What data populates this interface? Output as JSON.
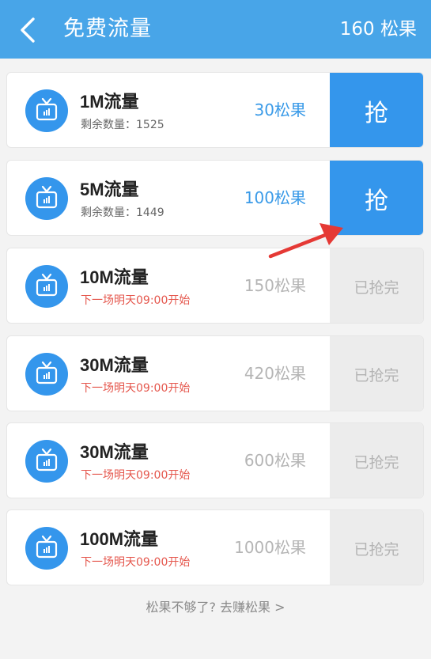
{
  "header": {
    "title": "免费流量",
    "balance": "160 松果",
    "back_icon": "chevron-left-icon"
  },
  "colors": {
    "header_bg": "#48a5e8",
    "accent": "#3496ec",
    "price_active": "#3b9be8",
    "sold_out_bg": "#ececec",
    "notice_red": "#e5574d"
  },
  "items": [
    {
      "title": "1M流量",
      "sub": "剩余数量：1525",
      "price": "30松果",
      "action": "抢",
      "status": "available"
    },
    {
      "title": "5M流量",
      "sub": "剩余数量：1449",
      "price": "100松果",
      "action": "抢",
      "status": "available"
    },
    {
      "title": "10M流量",
      "sub": "下一场明天09:00开始",
      "price": "150松果",
      "action": "已抢完",
      "status": "sold_out"
    },
    {
      "title": "30M流量",
      "sub": "下一场明天09:00开始",
      "price": "420松果",
      "action": "已抢完",
      "status": "sold_out"
    },
    {
      "title": "30M流量",
      "sub": "下一场明天09:00开始",
      "price": "600松果",
      "action": "已抢完",
      "status": "sold_out"
    },
    {
      "title": "100M流量",
      "sub": "下一场明天09:00开始",
      "price": "1000松果",
      "action": "已抢完",
      "status": "sold_out"
    }
  ],
  "footer": {
    "link": "松果不够了? 去赚松果 >"
  }
}
